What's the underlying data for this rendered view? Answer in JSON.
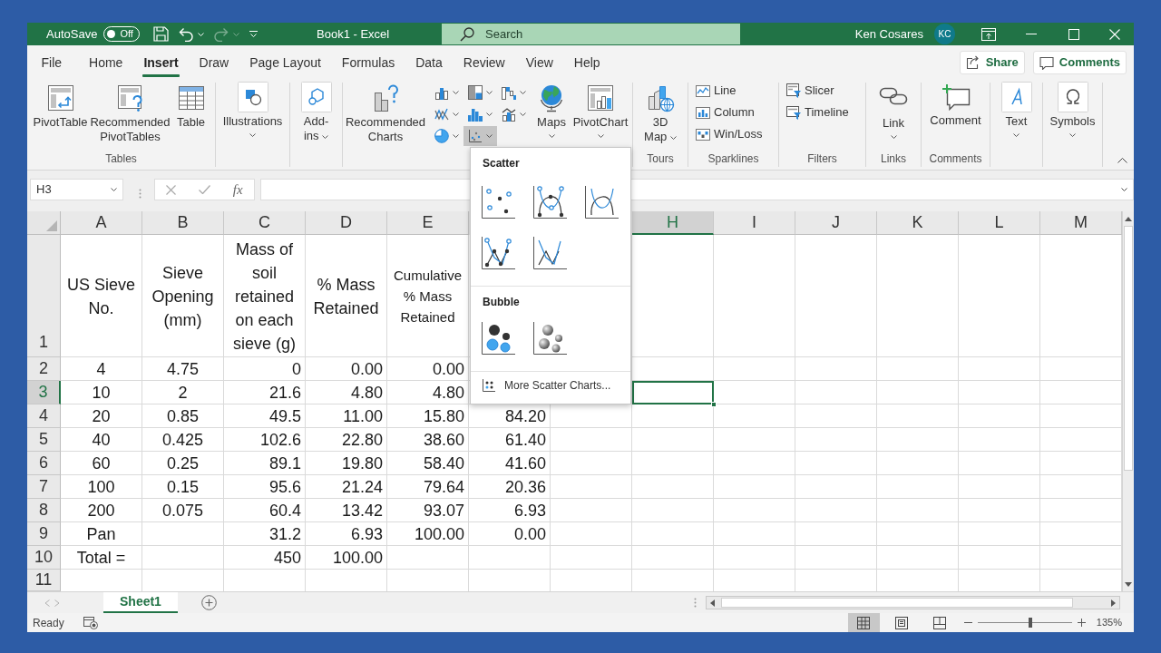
{
  "title_bar": {
    "autosave": {
      "label": "AutoSave",
      "toggle_text": "Off",
      "on": false
    },
    "quick_access": [
      {
        "disabled": false
      },
      {
        "disabled": false
      },
      {
        "disabled": true
      },
      {
        "disabled": false
      }
    ],
    "title": "Book1 - Excel",
    "search": {
      "placeholder": "Search"
    },
    "user": {
      "name": "Ken Cosares",
      "initials": "KC"
    }
  },
  "menu_tabs": [
    {
      "label": "File",
      "selected": false
    },
    {
      "label": "Home",
      "selected": false
    },
    {
      "label": "Insert",
      "selected": true
    },
    {
      "label": "Draw",
      "selected": false
    },
    {
      "label": "Page Layout",
      "selected": false
    },
    {
      "label": "Formulas",
      "selected": false
    },
    {
      "label": "Data",
      "selected": false
    },
    {
      "label": "Review",
      "selected": false
    },
    {
      "label": "View",
      "selected": false
    },
    {
      "label": "Help",
      "selected": false
    }
  ],
  "share_button": {
    "label": "Share"
  },
  "comments_button": {
    "label": "Comments"
  },
  "ribbon": {
    "groups": [
      {
        "label": "Tables",
        "items": [
          {
            "kind": "large",
            "label": "PivotTable",
            "dropdown": false
          },
          {
            "kind": "large",
            "label": "Recommended PivotTables",
            "dropdown": false
          },
          {
            "kind": "large",
            "label": "Table",
            "dropdown": false
          }
        ]
      },
      {
        "items": [
          {
            "kind": "tile",
            "label": "Illustrations",
            "dropdown": true
          }
        ]
      },
      {
        "items": [
          {
            "kind": "tile",
            "label": "Add-ins",
            "dropdown": true
          }
        ]
      },
      {
        "items": [
          {
            "kind": "large",
            "label": "Recommended Charts",
            "dropdown": false
          },
          {
            "kind": "icon_grid",
            "buttons": [
              {
                "expanded": false
              },
              {
                "expanded": false
              },
              {
                "expanded": false
              },
              {
                "expanded": false
              },
              {
                "expanded": false
              },
              {
                "expanded": false
              },
              {
                "expanded": false
              },
              {
                "expanded": true
              }
            ]
          },
          {
            "kind": "large",
            "label": "Maps",
            "dropdown": true
          },
          {
            "kind": "large",
            "label": "PivotChart",
            "dropdown": true
          }
        ]
      },
      {
        "label": "Tours",
        "items": [
          {
            "kind": "large",
            "label": "3D Map",
            "dropdown": true
          }
        ]
      },
      {
        "label": "Sparklines",
        "items": [
          {
            "kind": "small_stack",
            "buttons": [
              {
                "label": "Line"
              },
              {
                "label": "Column"
              },
              {
                "label": "Win/Loss"
              }
            ]
          }
        ]
      },
      {
        "label": "Filters",
        "items": [
          {
            "kind": "small_stack",
            "buttons": [
              {
                "label": "Slicer"
              },
              {
                "label": "Timeline"
              }
            ]
          }
        ]
      },
      {
        "label": "Links",
        "items": [
          {
            "kind": "large",
            "label": "Link",
            "dropdown": true
          }
        ]
      },
      {
        "label": "Comments",
        "items": [
          {
            "kind": "large",
            "label": "Comment",
            "dropdown": false
          }
        ]
      },
      {
        "items": [
          {
            "kind": "tile",
            "label": "Text",
            "dropdown": true
          }
        ]
      },
      {
        "items": [
          {
            "kind": "tile",
            "label": "Symbols",
            "dropdown": true
          }
        ]
      }
    ]
  },
  "formula_bar": {
    "name_box": "H3",
    "function_label": "fx"
  },
  "sheet": {
    "columns": [
      {
        "label": "A",
        "selected": false
      },
      {
        "label": "B",
        "selected": false
      },
      {
        "label": "C",
        "selected": false
      },
      {
        "label": "D",
        "selected": false
      },
      {
        "label": "E",
        "selected": false
      },
      null,
      null,
      {
        "label": "H",
        "selected": true
      },
      {
        "label": "I",
        "selected": false
      },
      {
        "label": "J",
        "selected": false
      },
      {
        "label": "K",
        "selected": false
      },
      {
        "label": "L",
        "selected": false
      },
      {
        "label": "M",
        "selected": false
      }
    ],
    "rows": [
      {
        "label": "1",
        "selected": false,
        "cells": [
          "US Sieve No.",
          "Sieve Opening (mm)",
          "Mass of soil retained on each sieve (g)",
          "% Mass Retained",
          "Cumulative % Mass Retained"
        ]
      },
      {
        "label": "2",
        "selected": false,
        "cells": [
          "4",
          "4.75",
          "0",
          "0.00",
          "0.00"
        ]
      },
      {
        "label": "3",
        "selected": true,
        "cells": [
          "10",
          "2",
          "21.6",
          "4.80",
          "4.80"
        ]
      },
      {
        "label": "4",
        "selected": false,
        "cells": [
          "20",
          "0.85",
          "49.5",
          "11.00",
          "15.80",
          "84.20"
        ]
      },
      {
        "label": "5",
        "selected": false,
        "cells": [
          "40",
          "0.425",
          "102.6",
          "22.80",
          "38.60",
          "61.40"
        ]
      },
      {
        "label": "6",
        "selected": false,
        "cells": [
          "60",
          "0.25",
          "89.1",
          "19.80",
          "58.40",
          "41.60"
        ]
      },
      {
        "label": "7",
        "selected": false,
        "cells": [
          "100",
          "0.15",
          "95.6",
          "21.24",
          "79.64",
          "20.36"
        ]
      },
      {
        "label": "8",
        "selected": false,
        "cells": [
          "200",
          "0.075",
          "60.4",
          "13.42",
          "93.07",
          "6.93"
        ]
      },
      {
        "label": "9",
        "selected": false,
        "cells": [
          "Pan",
          null,
          "31.2",
          "6.93",
          "100.00",
          "0.00"
        ]
      },
      {
        "label": "10",
        "selected": false,
        "cells": [
          "Total =",
          null,
          "450",
          "100.00"
        ]
      },
      {
        "label": "11",
        "selected": false
      }
    ]
  },
  "scatter_menu": {
    "sections": [
      {
        "heading": "Scatter"
      },
      {
        "heading": "Bubble"
      }
    ],
    "more_link": "More Scatter Charts..."
  },
  "sheet_tabs": [
    {
      "label": "Sheet1",
      "selected": true
    }
  ],
  "status_bar": {
    "status": "Ready",
    "views": [
      {
        "selected": true
      },
      {
        "selected": false
      },
      {
        "selected": false
      }
    ],
    "zoom": {
      "level": 0.56,
      "reading": "135%"
    }
  }
}
